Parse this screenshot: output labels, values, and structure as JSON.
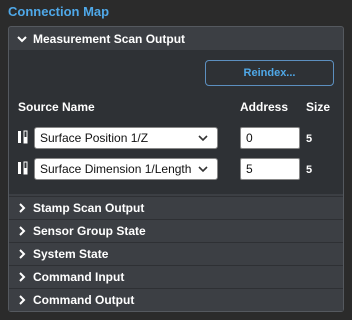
{
  "panel": {
    "title": "Connection Map"
  },
  "sections": [
    {
      "label": "Measurement Scan Output",
      "expanded": true,
      "reindex_label": "Reindex...",
      "columns": {
        "source": "Source Name",
        "address": "Address",
        "size": "Size"
      },
      "rows": [
        {
          "source": "Surface Position 1/Z",
          "address": "0",
          "size": "5"
        },
        {
          "source": "Surface Dimension 1/Length",
          "address": "5",
          "size": "5"
        }
      ]
    },
    {
      "label": "Stamp Scan Output",
      "expanded": false
    },
    {
      "label": "Sensor Group State",
      "expanded": false
    },
    {
      "label": "System State",
      "expanded": false
    },
    {
      "label": "Command Input",
      "expanded": false
    },
    {
      "label": "Command Output",
      "expanded": false
    }
  ],
  "icons": {
    "expanded": "chevron-down-icon",
    "collapsed": "chevron-right-icon",
    "drag": "drag-handle-icon",
    "dropdown": "chevron-down-icon"
  },
  "colors": {
    "accent": "#4fa8e8",
    "background": "#2b2b2b",
    "section": "#3c3f44",
    "body": "#2e3135"
  }
}
